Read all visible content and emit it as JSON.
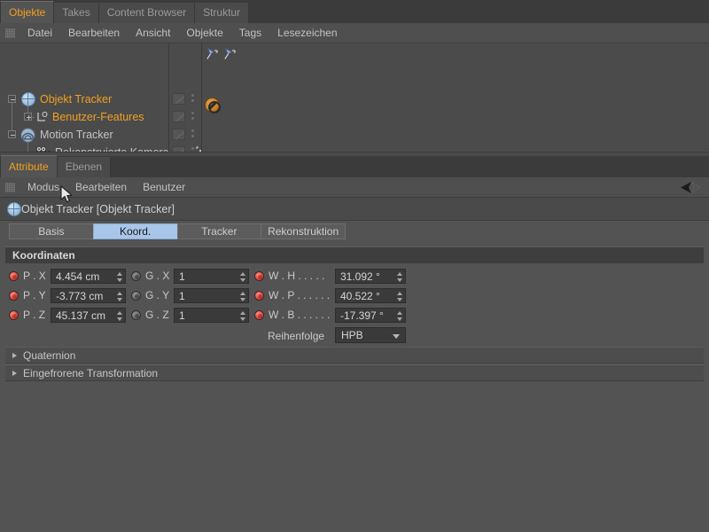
{
  "top_tabs": [
    {
      "label": "Objekte",
      "active": true
    },
    {
      "label": "Takes",
      "active": false
    },
    {
      "label": "Content Browser",
      "active": false
    },
    {
      "label": "Struktur",
      "active": false
    }
  ],
  "object_manager": {
    "menu": [
      "Datei",
      "Bearbeiten",
      "Ansicht",
      "Objekte",
      "Tags",
      "Lesezeichen"
    ],
    "rows": [
      {
        "name": "Objekt Tracker",
        "icon": "sphere-tracker-icon",
        "color": "#f0a020",
        "depth": 0,
        "selected": true,
        "tags": [
          "pin-tag-icon",
          "pin-tag-icon"
        ]
      },
      {
        "name": "Benutzer-Features",
        "icon": "layer-zero-icon",
        "color": "#f0a020",
        "depth": 1,
        "selected": false,
        "tags": []
      },
      {
        "name": "Motion Tracker",
        "icon": "motion-tracker-icon",
        "color": "#c4c4c4",
        "depth": 0,
        "selected": false,
        "tags": []
      },
      {
        "name": "Rekonstruierte Kamera",
        "icon": "camera-icon",
        "color": "#c4c4c4",
        "depth": 1,
        "selected": false,
        "tags": [
          "disabled-tag-icon"
        ]
      }
    ]
  },
  "attribute_manager": {
    "tabs": [
      {
        "label": "Attribute",
        "active": true
      },
      {
        "label": "Ebenen",
        "active": false
      }
    ],
    "menu": [
      "Modus",
      "Bearbeiten",
      "Benutzer"
    ],
    "object_title": "Objekt Tracker [Objekt Tracker]",
    "property_tabs": [
      {
        "label": "Basis",
        "selected": false
      },
      {
        "label": "Koord.",
        "selected": true
      },
      {
        "label": "Tracker",
        "selected": false
      },
      {
        "label": "Rekonstruktion",
        "selected": false
      }
    ],
    "section_title": "Koordinaten",
    "coordinates": {
      "position": [
        {
          "radio": "on",
          "label": "P . X",
          "value": "4.454 cm"
        },
        {
          "radio": "on",
          "label": "P . Y",
          "value": "-3.773 cm"
        },
        {
          "radio": "on",
          "label": "P . Z",
          "value": "45.137 cm"
        }
      ],
      "scale": [
        {
          "radio": "off",
          "label": "G . X",
          "value": "1"
        },
        {
          "radio": "off",
          "label": "G . Y",
          "value": "1"
        },
        {
          "radio": "off",
          "label": "G . Z",
          "value": "1"
        }
      ],
      "rotation": [
        {
          "radio": "on",
          "label": "W . H . . . . .",
          "value": "31.092 °"
        },
        {
          "radio": "on",
          "label": "W . P . . . . . .",
          "value": "40.522 °"
        },
        {
          "radio": "on",
          "label": "W . B . . . . . .",
          "value": "-17.397 °"
        }
      ]
    },
    "order_label": "Reihenfolge",
    "order_value": "HPB",
    "collapsed_sections": [
      {
        "label": "Quaternion"
      },
      {
        "label": "Eingefrorene Transformation"
      }
    ]
  },
  "colors": {
    "accent_orange": "#f0a020",
    "tab_selected_blue": "#a8c6ea",
    "radio_active_red": "#e8483c",
    "panel_bg": "#535353",
    "field_bg": "#3a3a3a"
  }
}
